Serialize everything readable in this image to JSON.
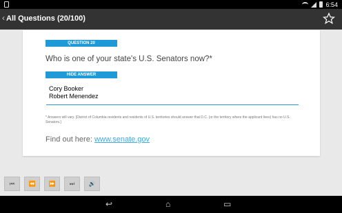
{
  "status_bar": {
    "time": "6:54"
  },
  "action_bar": {
    "back_glyph": "‹",
    "title": "All Questions (20/100)",
    "star_icon": "star-outline-icon"
  },
  "question": {
    "label": "QUESTION 20",
    "text": "Who is one of your state's U.S. Senators now?*",
    "hide_label": "HIDE ANSWER",
    "answers": [
      "Cory Booker",
      "Robert Menendez"
    ],
    "note": "* Answers will vary. [District of Columbia residents and residents of U.S. territories should answer that D.C. (or the territory where the applicant lives) has no U.S. Senators.]",
    "find_out_prefix": "Find out here: ",
    "find_out_link": "www.senate.gov"
  },
  "controls": [
    {
      "icon": "skip-previous-icon",
      "glyph": "⏮"
    },
    {
      "icon": "rewind-icon",
      "glyph": "⏪"
    },
    {
      "icon": "fast-forward-icon",
      "glyph": "⏩"
    },
    {
      "icon": "skip-next-icon",
      "glyph": "⏭"
    },
    {
      "icon": "volume-icon",
      "glyph": "🔊"
    }
  ],
  "nav_bar": {
    "back": "↩",
    "home": "⌂",
    "recents": "▭"
  },
  "colors": {
    "accent": "#1f9ad6",
    "actionbar": "#333333",
    "link": "#3aa9e0"
  }
}
